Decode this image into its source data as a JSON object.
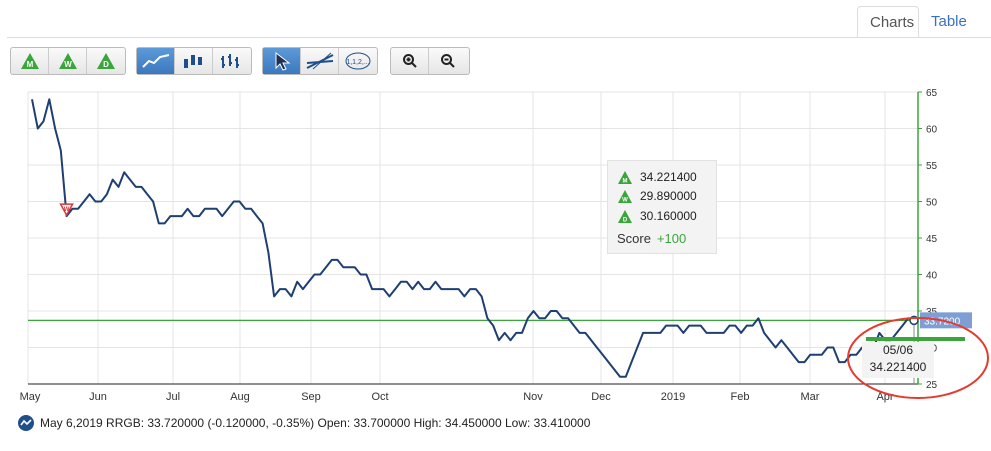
{
  "tabs": {
    "charts": "Charts",
    "table": "Table"
  },
  "toolbar": {
    "period_buttons": [
      "M",
      "W",
      "D"
    ],
    "zoom_in_icon": "zoom-in-icon",
    "zoom_out_icon": "zoom-out-icon"
  },
  "colors": {
    "line": "#1f3f73",
    "green": "#3aa53a",
    "accent": "#4a7fc1",
    "signal_red": "#d9373a",
    "annotation": "#e53a2e"
  },
  "tooltip": {
    "rows": [
      {
        "icon": "M",
        "value": "34.221400"
      },
      {
        "icon": "W",
        "value": "29.890000"
      },
      {
        "icon": "D",
        "value": "30.160000"
      }
    ],
    "score_label": "Score",
    "score_value": "+100"
  },
  "hover": {
    "date": "05/06",
    "value": "34.221400"
  },
  "price_label": "33.7200",
  "footer": {
    "text": "May 6,2019 RRGB: 33.720000 (-0.120000, -0.35%) Open: 33.700000 High: 34.450000 Low: 33.410000"
  },
  "chart_data": {
    "type": "line",
    "x_labels": [
      "May",
      "Jun",
      "Jul",
      "Aug",
      "Sep",
      "Oct",
      "Nov",
      "Dec",
      "2019",
      "Feb",
      "Mar",
      "Apr"
    ],
    "y_ticks": [
      25,
      30,
      35,
      40,
      45,
      50,
      55,
      60,
      65
    ],
    "ylim": [
      25,
      65
    ],
    "grid": true,
    "reference_line": 33.72,
    "series": [
      {
        "values": [
          64,
          60,
          61,
          64,
          60,
          57,
          48,
          49,
          49,
          50,
          51,
          50,
          50,
          51,
          53,
          52,
          54,
          53,
          52,
          52,
          51,
          50,
          47,
          47,
          48,
          48,
          48,
          49,
          48,
          48,
          49,
          49,
          49,
          48,
          49,
          50,
          50,
          49,
          49,
          48,
          47,
          43,
          37,
          38,
          38,
          37,
          39,
          38,
          39,
          40,
          40,
          41,
          42,
          42,
          41,
          41,
          41,
          40,
          40,
          38,
          38,
          38,
          37,
          38,
          39,
          39,
          38,
          39,
          38,
          38,
          39,
          38,
          38,
          38,
          38,
          37,
          38,
          38,
          37,
          34,
          33,
          31,
          32,
          31,
          32,
          32,
          34,
          35,
          34,
          34,
          35,
          35,
          34,
          34,
          33,
          32,
          32,
          31,
          30,
          29,
          28,
          27,
          26,
          26,
          28,
          30,
          32,
          32,
          32,
          32,
          33,
          33,
          33,
          32,
          33,
          33,
          33,
          32,
          32,
          32,
          32,
          33,
          33,
          32,
          33,
          33,
          34,
          32,
          31,
          30,
          31,
          30,
          29,
          28,
          28,
          29,
          29,
          29,
          30,
          30,
          28,
          28,
          29,
          29,
          30,
          29,
          30,
          32,
          31,
          31,
          32,
          33,
          34,
          33.72
        ],
        "signals": [
          {
            "type": "W",
            "direction": "sell",
            "index": 6
          },
          {
            "type": "M",
            "direction": "buy",
            "index": 155
          }
        ]
      }
    ]
  }
}
